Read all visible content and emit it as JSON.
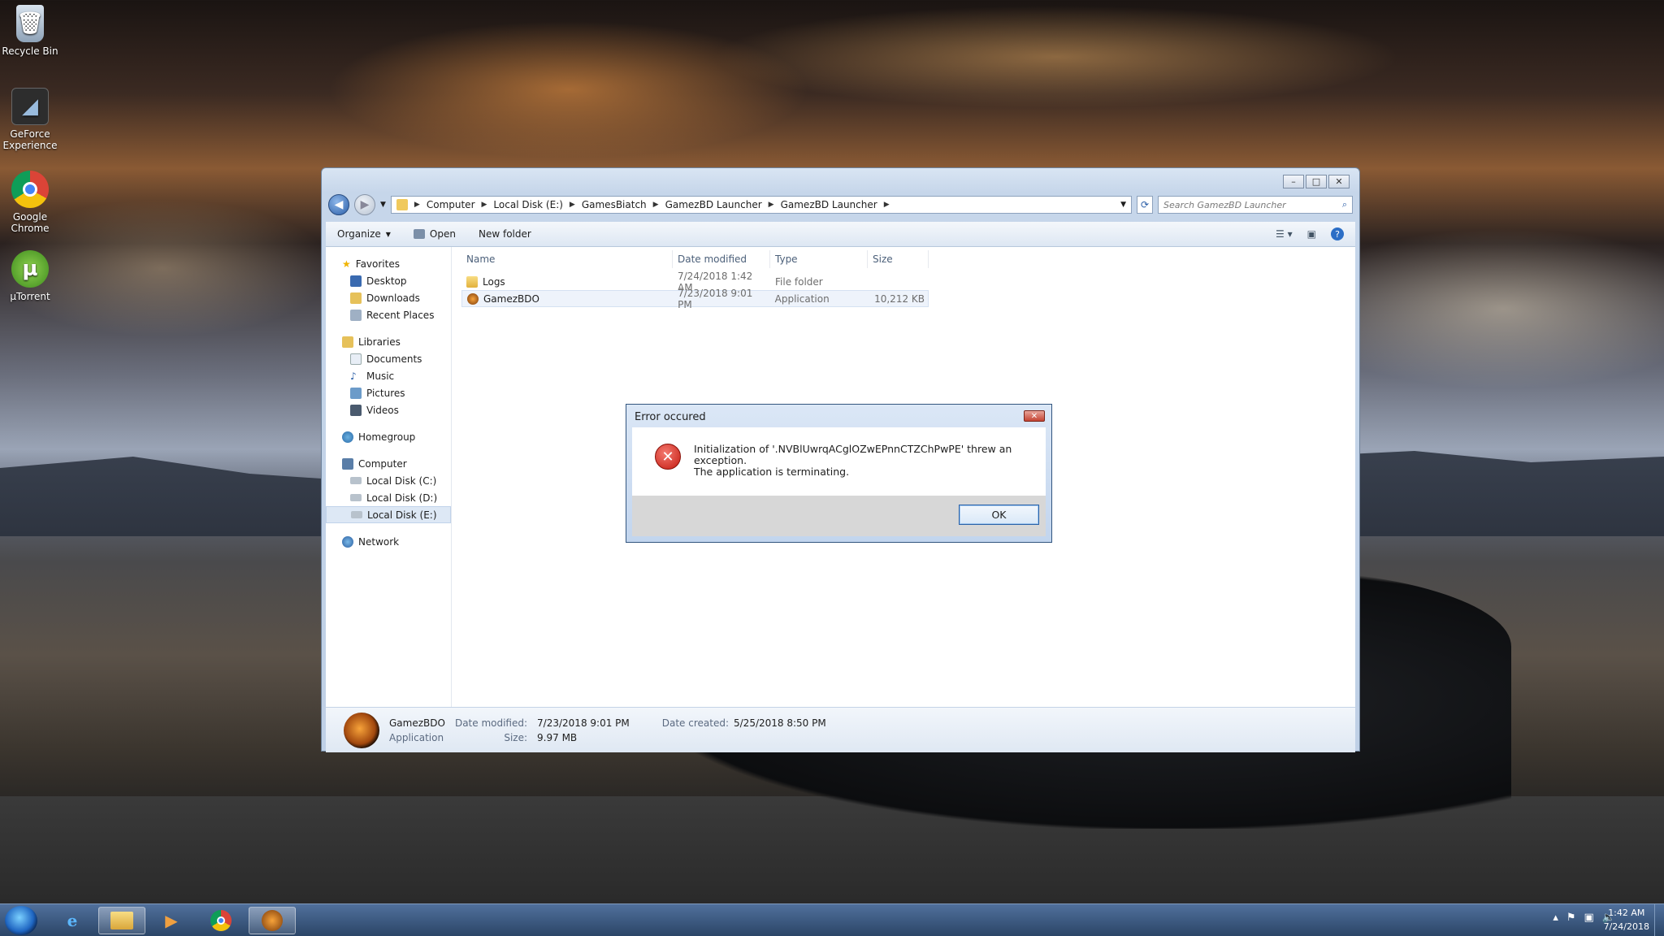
{
  "desktop": {
    "icons": [
      {
        "label": "Recycle Bin",
        "icon": "recycle-bin-icon"
      },
      {
        "label": "GeForce Experience",
        "icon": "geforce-icon"
      },
      {
        "label": "Google Chrome",
        "icon": "chrome-icon"
      },
      {
        "label": "µTorrent",
        "icon": "utorrent-icon"
      }
    ]
  },
  "explorer": {
    "breadcrumb": [
      "Computer",
      "Local Disk (E:)",
      "GamesBiatch",
      "GamezBD Launcher",
      "GamezBD Launcher"
    ],
    "search_placeholder": "Search GamezBD Launcher",
    "toolbar": {
      "organize": "Organize",
      "open": "Open",
      "new_folder": "New folder"
    },
    "nav": {
      "favorites": {
        "label": "Favorites",
        "items": [
          "Desktop",
          "Downloads",
          "Recent Places"
        ]
      },
      "libraries": {
        "label": "Libraries",
        "items": [
          "Documents",
          "Music",
          "Pictures",
          "Videos"
        ]
      },
      "homegroup": "Homegroup",
      "computer": {
        "label": "Computer",
        "items": [
          "Local Disk (C:)",
          "Local Disk (D:)",
          "Local Disk (E:)"
        ]
      },
      "network": "Network"
    },
    "columns": [
      "Name",
      "Date modified",
      "Type",
      "Size"
    ],
    "files": [
      {
        "name": "Logs",
        "date": "7/24/2018 1:42 AM",
        "type": "File folder",
        "size": ""
      },
      {
        "name": "GamezBDO",
        "date": "7/23/2018 9:01 PM",
        "type": "Application",
        "size": "10,212 KB"
      }
    ],
    "details": {
      "name": "GamezBDO",
      "kind": "Application",
      "modified_label": "Date modified:",
      "modified": "7/23/2018 9:01 PM",
      "size_label": "Size:",
      "size": "9.97 MB",
      "created_label": "Date created:",
      "created": "5/25/2018 8:50 PM"
    }
  },
  "dialog": {
    "title": "Error occured",
    "line1": "Initialization of '.NVBlUwrqACglOZwEPnnCTZChPwPE' threw an exception.",
    "line2": "The application is terminating.",
    "ok": "OK"
  },
  "taskbar": {
    "time": "1:42 AM",
    "date": "7/24/2018"
  },
  "colors": {
    "accent": "#2c5fa8",
    "error": "#c41a10"
  }
}
